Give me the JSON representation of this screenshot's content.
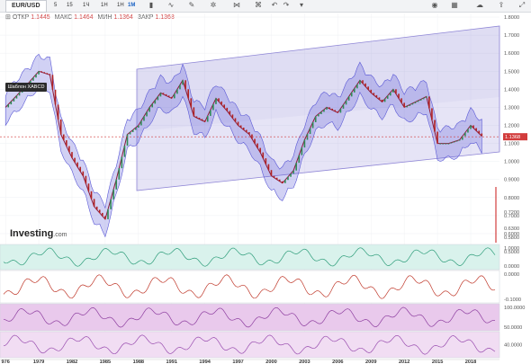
{
  "toolbar": {
    "symbol": "EUR/USD",
    "timeframes": [
      "5",
      "15",
      "1Ч",
      "1Н",
      "1М",
      "1Н"
    ],
    "active_timeframe": "1М"
  },
  "ohlc": {
    "open_label": "ОТКР",
    "open": "1.1445",
    "high_label": "МАКС",
    "high": "1.1464",
    "low_label": "МИН",
    "low": "1.1364",
    "close_label": "ЗАКР",
    "close": "1.1368"
  },
  "tooltip": "Шаблон XABCD",
  "logo": {
    "main": "Investing",
    "suffix": ".com"
  },
  "chart_data": [
    {
      "type": "line",
      "title": "",
      "price_axis_labels": [
        "1.8000",
        "1.7000",
        "1.6000",
        "1.5000",
        "1.4000",
        "1.3000",
        "1.2000",
        "1.1000",
        "1.0000",
        "0.9000",
        "0.8000",
        "0.7000",
        "0.6000",
        "0.5000"
      ],
      "extra_axis_labels": [
        "0.7200",
        "0.6300",
        "0.5800"
      ],
      "last_price": "1.1368",
      "x_tick_labels": [
        "976",
        "1979",
        "1982",
        "1985",
        "1988",
        "1991",
        "1994",
        "1997",
        "2000",
        "2003",
        "2006",
        "2009",
        "2012",
        "2015",
        "2018"
      ],
      "x": [
        1976,
        1978,
        1979,
        1980,
        1981,
        1982,
        1983,
        1984,
        1985,
        1986,
        1987,
        1988,
        1989,
        1990,
        1991,
        1992,
        1993,
        1994,
        1995,
        1996,
        1997,
        1998,
        1999,
        2000,
        2001,
        2002,
        2003,
        2004,
        2005,
        2006,
        2007,
        2008,
        2009,
        2010,
        2011,
        2012,
        2013,
        2014,
        2015,
        2016,
        2017,
        2018,
        2019
      ],
      "series": [
        {
          "values": [
            1.3,
            1.43,
            1.5,
            1.48,
            1.15,
            1.02,
            0.92,
            0.75,
            0.68,
            0.9,
            1.15,
            1.2,
            1.3,
            1.38,
            1.35,
            1.45,
            1.25,
            1.22,
            1.35,
            1.28,
            1.2,
            1.15,
            1.05,
            0.92,
            0.88,
            0.95,
            1.12,
            1.25,
            1.3,
            1.27,
            1.36,
            1.45,
            1.38,
            1.33,
            1.4,
            1.3,
            1.33,
            1.36,
            1.1,
            1.1,
            1.12,
            1.2,
            1.14
          ]
        }
      ],
      "ylim": [
        0.55,
        1.82
      ],
      "xlim": [
        1975.5,
        2020.6
      ],
      "grid": true
    },
    {
      "type": "line",
      "title": "",
      "axis_labels": [
        "1.0000",
        "0.0000"
      ],
      "ylim": [
        -1.3,
        1.3
      ]
    },
    {
      "type": "line",
      "title": "",
      "axis_labels": [
        "0.0000",
        "-0.1000"
      ],
      "ylim": [
        -0.12,
        0.05
      ]
    },
    {
      "type": "line",
      "title": "",
      "axis_labels": [
        "100.0000",
        "50.0000"
      ],
      "ylim": [
        0,
        110
      ]
    },
    {
      "type": "line",
      "title": "",
      "axis_labels": [
        "40.0000"
      ],
      "ylim": [
        0,
        80
      ]
    }
  ],
  "colors": {
    "accent": "#1a62c4",
    "price_line": "#d23c3c",
    "band": "#6a5acd",
    "channel": "#9088d4",
    "candle_up": "#2e8b57",
    "candle_down": "#b22222"
  }
}
